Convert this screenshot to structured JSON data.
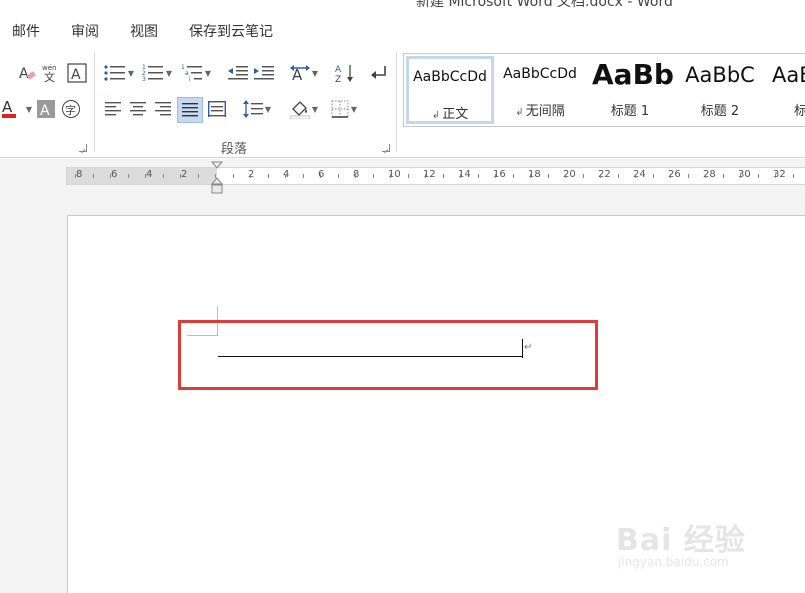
{
  "window": {
    "title": "新建 Microsoft Word 文档.docx - Word"
  },
  "menu": {
    "tabs": [
      "邮件",
      "审阅",
      "视图",
      "保存到云笔记"
    ]
  },
  "ribbon": {
    "paragraph_group_label": "段落",
    "styles": [
      {
        "sample": "AaBbCcDd",
        "name": "正文",
        "selected": true
      },
      {
        "sample": "AaBbCcDd",
        "name": "无间隔",
        "selected": false
      },
      {
        "sample": "AaBb",
        "name": "标题 1",
        "selected": false
      },
      {
        "sample": "AaBbC",
        "name": "标题 2",
        "selected": false
      },
      {
        "sample": "AaBl",
        "name": "标",
        "selected": false
      }
    ],
    "accent": "#c6d9f1",
    "font_color": "#e32020"
  },
  "ruler": {
    "numbers": [
      "8",
      "6",
      "4",
      "2",
      "2",
      "4",
      "6",
      "8",
      "10",
      "12",
      "14",
      "16",
      "18",
      "20",
      "22",
      "24",
      "26",
      "28",
      "30",
      "32"
    ]
  },
  "document": {
    "paragraph_mark": "↵",
    "highlight_color": "#e03b3b"
  },
  "watermark": {
    "brand": "Bai 经验",
    "url": "jingyan.baidu.com"
  }
}
